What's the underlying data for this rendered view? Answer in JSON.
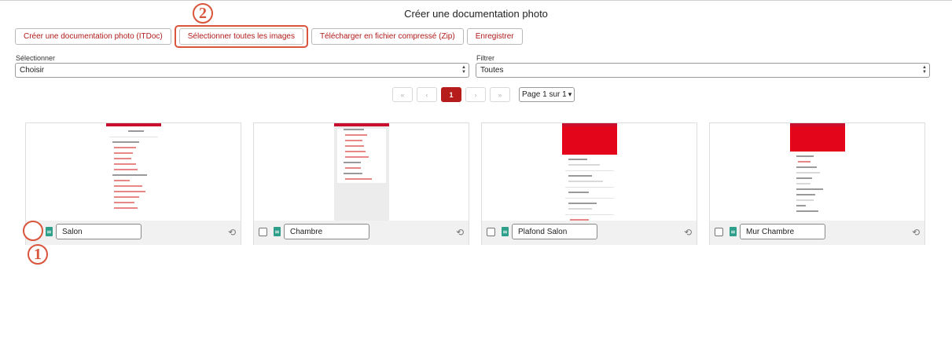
{
  "title": "Créer une documentation photo",
  "toolbar": {
    "create_itdoc": "Créer une documentation photo (ITDoc)",
    "select_all": "Sélectionner toutes les images",
    "download_zip": "Télécharger en fichier compressé (Zip)",
    "save": "Enregistrer"
  },
  "filters": {
    "select_label": "Sélectionner",
    "select_value": "Choisir",
    "filter_label": "Filtrer",
    "filter_value": "Toutes"
  },
  "pagination": {
    "first": "«",
    "prev": "‹",
    "current": "1",
    "next": "›",
    "last": "»",
    "page_select": "Page 1 sur 1"
  },
  "cards": [
    {
      "name": "Salon",
      "icon": "file-icon"
    },
    {
      "name": "Chambre",
      "icon": "file-icon"
    },
    {
      "name": "Plafond Salon",
      "icon": "file-icon"
    },
    {
      "name": "Mur Chambre",
      "icon": "file-icon"
    }
  ],
  "callouts": {
    "one": "1",
    "two": "2"
  },
  "colors": {
    "accent": "#b71c1c",
    "callout": "#d9553c",
    "file_icon": "#2e9f8a"
  }
}
